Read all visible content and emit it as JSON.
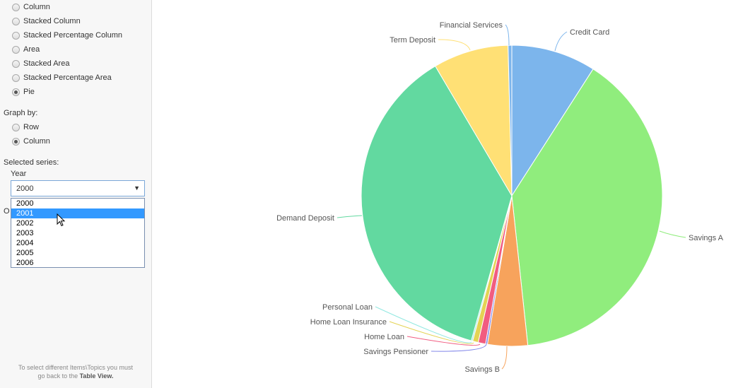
{
  "sidebar": {
    "chart_types": [
      {
        "label": "Column",
        "checked": false
      },
      {
        "label": "Stacked Column",
        "checked": false
      },
      {
        "label": "Stacked Percentage Column",
        "checked": false
      },
      {
        "label": "Area",
        "checked": false
      },
      {
        "label": "Stacked Area",
        "checked": false
      },
      {
        "label": "Stacked Percentage Area",
        "checked": false
      },
      {
        "label": "Pie",
        "checked": true
      }
    ],
    "graph_by_label": "Graph by:",
    "graph_by": [
      {
        "label": "Row",
        "checked": false
      },
      {
        "label": "Column",
        "checked": true
      }
    ],
    "selected_series_label": "Selected series:",
    "year_label": "Year",
    "year_select": {
      "value": "2000",
      "arrow": "▼"
    },
    "year_options": [
      "2000",
      "2001",
      "2002",
      "2003",
      "2004",
      "2005",
      "2006"
    ],
    "highlighted_option": "2001",
    "hidden_label_fragment": "O",
    "footer_text": "To select different Items\\Topics you must",
    "footer_text2": "go back to the ",
    "footer_bold": "Table View."
  },
  "chart_data": {
    "type": "pie",
    "title": "",
    "series_name": "2000",
    "start": "top, clockwise",
    "slices": [
      {
        "label": "Credit Card",
        "value": 9.1,
        "color": "#7cb5ec"
      },
      {
        "label": "Savings A",
        "value": 39.3,
        "color": "#90ed7d"
      },
      {
        "label": "Savings B",
        "value": 4.3,
        "color": "#f7a35c"
      },
      {
        "label": "Savings Pensioner",
        "value": 0.2,
        "color": "#8085e9"
      },
      {
        "label": "Home Loan",
        "value": 0.8,
        "color": "#f15c80"
      },
      {
        "label": "Home Loan Insurance",
        "value": 0.6,
        "color": "#e4d354"
      },
      {
        "label": "Personal Loan",
        "value": 0.15,
        "color": "#91e8e1"
      },
      {
        "label": "Demand Deposit",
        "value": 37.25,
        "color": "#62d9a0"
      },
      {
        "label": "Term Deposit",
        "value": 8.1,
        "color": "#ffe075"
      },
      {
        "label": "Financial Services",
        "value": 0.4,
        "color": "#7cb5ec"
      }
    ],
    "legend": "none",
    "data_labels": "outside with connectors"
  }
}
